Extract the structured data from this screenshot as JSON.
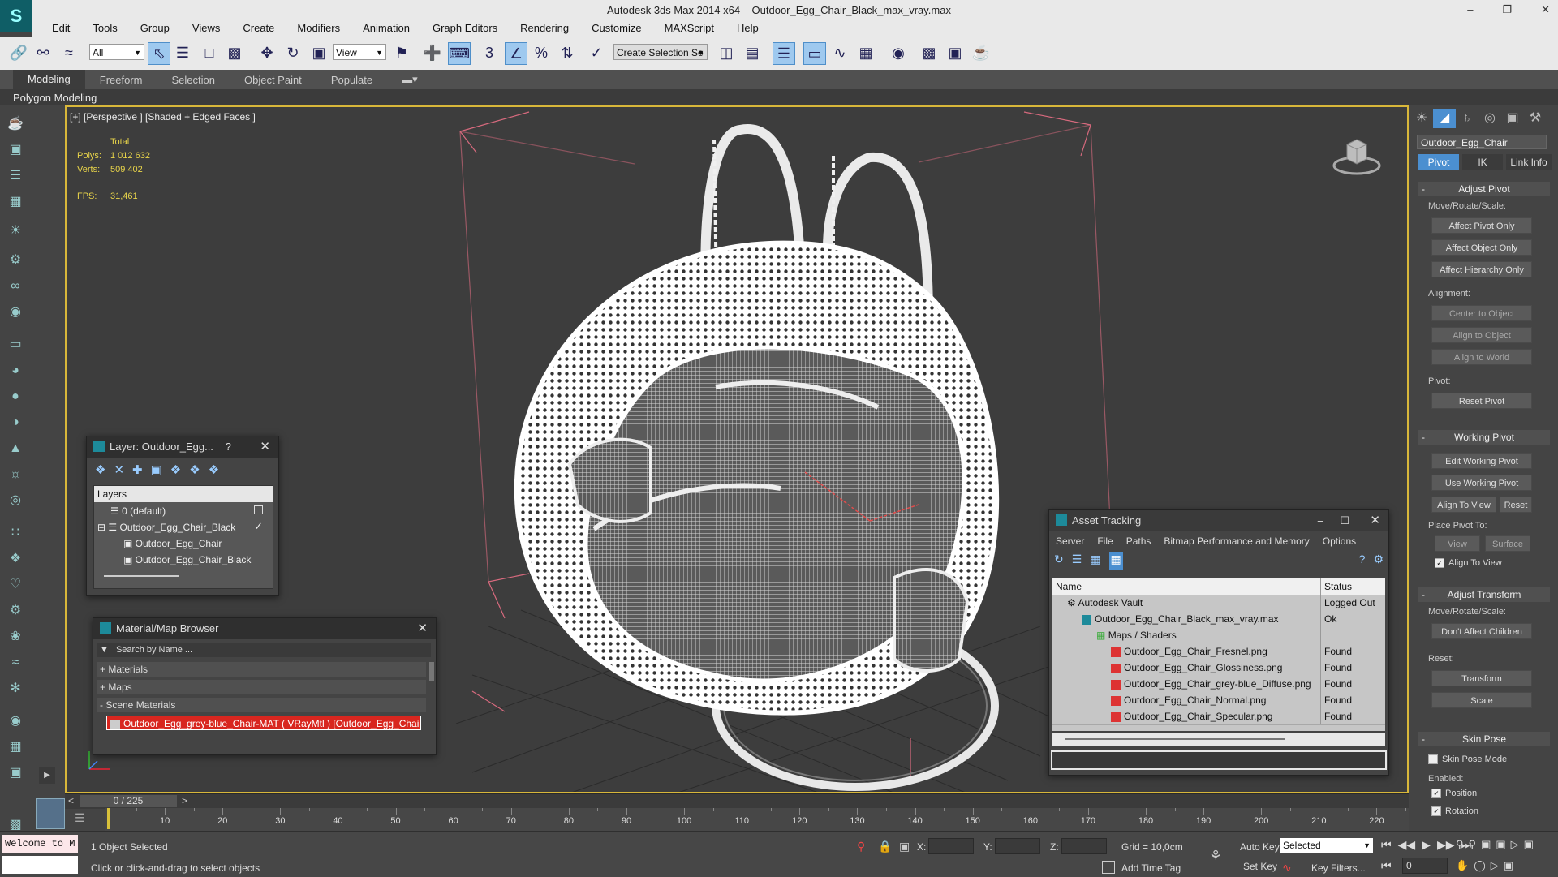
{
  "window": {
    "app": "Autodesk 3ds Max  2014 x64",
    "file": "Outdoor_Egg_Chair_Black_max_vray.max"
  },
  "menu": [
    "Edit",
    "Tools",
    "Group",
    "Views",
    "Create",
    "Modifiers",
    "Animation",
    "Graph Editors",
    "Rendering",
    "Customize",
    "MAXScript",
    "Help"
  ],
  "toolbar": {
    "filter": "All",
    "ref_coord": "View",
    "selection_set_placeholder": "Create Selection Se"
  },
  "ribbon": {
    "tabs": [
      "Modeling",
      "Freeform",
      "Selection",
      "Object Paint",
      "Populate"
    ],
    "active": "Modeling",
    "sub": "Polygon Modeling"
  },
  "viewport": {
    "label": "[+] [Perspective ] [Shaded + Edged Faces ]",
    "stats": {
      "total_label": "Total",
      "polys_label": "Polys:",
      "polys": "1 012 632",
      "verts_label": "Verts:",
      "verts": "509 402",
      "fps_label": "FPS:",
      "fps": "31,461"
    }
  },
  "layer_dialog": {
    "title": "Layer: Outdoor_Egg...",
    "help": "?",
    "header": "Layers",
    "items": [
      "0 (default)",
      "Outdoor_Egg_Chair_Black",
      "Outdoor_Egg_Chair",
      "Outdoor_Egg_Chair_Black"
    ]
  },
  "material_browser": {
    "title": "Material/Map Browser",
    "search_placeholder": "Search by Name ...",
    "groups": [
      "+ Materials",
      "+ Maps",
      "- Scene Materials"
    ],
    "selected_material": "Outdoor_Egg_grey-blue_Chair-MAT ( VRayMtl ) [Outdoor_Egg_Chair]"
  },
  "asset_tracking": {
    "title": "Asset Tracking",
    "menu": [
      "Server",
      "File",
      "Paths",
      "Bitmap Performance and Memory",
      "Options"
    ],
    "columns": [
      "Name",
      "Status"
    ],
    "rows": [
      {
        "name": "Autodesk Vault",
        "status": "Logged Out ..."
      },
      {
        "name": "Outdoor_Egg_Chair_Black_max_vray.max",
        "status": "Ok"
      },
      {
        "name": "Maps / Shaders",
        "status": ""
      },
      {
        "name": "Outdoor_Egg_Chair_Fresnel.png",
        "status": "Found"
      },
      {
        "name": "Outdoor_Egg_Chair_Glossiness.png",
        "status": "Found"
      },
      {
        "name": "Outdoor_Egg_Chair_grey-blue_Diffuse.png",
        "status": "Found"
      },
      {
        "name": "Outdoor_Egg_Chair_Normal.png",
        "status": "Found"
      },
      {
        "name": "Outdoor_Egg_Chair_Specular.png",
        "status": "Found"
      }
    ]
  },
  "command_panel": {
    "object_name": "Outdoor_Egg_Chair",
    "tabs": [
      "Pivot",
      "IK",
      "Link Info"
    ],
    "adjust_pivot": "Adjust Pivot",
    "move_rotate_scale": "Move/Rotate/Scale:",
    "affect_pivot_only": "Affect Pivot Only",
    "affect_object_only": "Affect Object Only",
    "affect_hierarchy_only": "Affect Hierarchy Only",
    "alignment": "Alignment:",
    "center_to_object": "Center to Object",
    "align_to_object": "Align to Object",
    "align_to_world": "Align to World",
    "pivot_label": "Pivot:",
    "reset_pivot": "Reset Pivot",
    "working_pivot": "Working Pivot",
    "edit_working_pivot": "Edit Working Pivot",
    "use_working_pivot": "Use Working Pivot",
    "align_to_view": "Align To View",
    "reset": "Reset",
    "place_pivot_to": "Place Pivot To:",
    "view": "View",
    "surface": "Surface",
    "align_to_view_chk": "Align To View",
    "adjust_transform": "Adjust Transform",
    "move_rotate_scale2": "Move/Rotate/Scale:",
    "dont_affect_children": "Don't Affect Children",
    "reset_label": "Reset:",
    "transform": "Transform",
    "scale": "Scale",
    "skin_pose": "Skin Pose",
    "skin_pose_mode": "Skin Pose Mode",
    "enabled": "Enabled:",
    "position": "Position",
    "rotation": "Rotation"
  },
  "timeline": {
    "frame": "0 / 225",
    "ticks": [
      "10",
      "20",
      "30",
      "40",
      "50",
      "60",
      "70",
      "80",
      "90",
      "100",
      "110",
      "120",
      "130",
      "140",
      "150",
      "160",
      "170",
      "180",
      "190",
      "200",
      "210",
      "220"
    ]
  },
  "status": {
    "welcome": "Welcome to M",
    "selected": "1 Object Selected",
    "hint": "Click or click-and-drag to select objects",
    "x_label": "X:",
    "y_label": "Y:",
    "z_label": "Z:",
    "grid": "Grid = 10,0cm",
    "add_time_tag": "Add Time Tag",
    "auto_key": "Auto Key",
    "set_key": "Set Key",
    "selected_combo": "Selected",
    "key_filters": "Key Filters...",
    "frame_field": "0"
  }
}
